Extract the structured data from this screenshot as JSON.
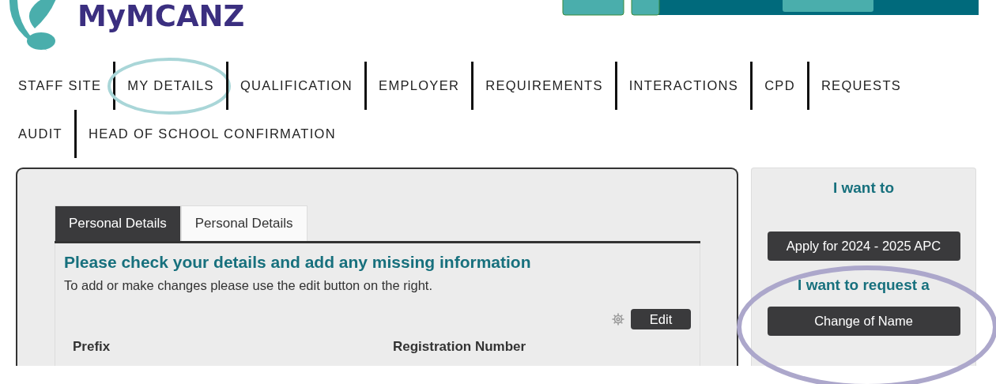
{
  "header": {
    "logo_text": "MyMCANZ"
  },
  "nav": {
    "rows": [
      [
        {
          "label": "STAFF SITE",
          "circled": false
        },
        {
          "label": "MY DETAILS",
          "circled": true
        },
        {
          "label": "QUALIFICATION",
          "circled": false
        },
        {
          "label": "EMPLOYER",
          "circled": false
        },
        {
          "label": "REQUIREMENTS",
          "circled": false
        },
        {
          "label": "INTERACTIONS",
          "circled": false
        },
        {
          "label": "CPD",
          "circled": false
        },
        {
          "label": "REQUESTS",
          "circled": false
        }
      ],
      [
        {
          "label": "AUDIT",
          "circled": false
        },
        {
          "label": "HEAD OF SCHOOL CONFIRMATION",
          "circled": false
        }
      ]
    ]
  },
  "main": {
    "tabs": [
      {
        "label": "Personal Details",
        "selected": true
      },
      {
        "label": "Personal Details",
        "selected": false
      }
    ],
    "heading": "Please check your details and add any missing information",
    "instructions": "To add or make changes please use the edit button on the right.",
    "edit_button": "Edit",
    "fields": [
      {
        "label": "Prefix"
      },
      {
        "label": "Registration Number"
      }
    ]
  },
  "sidebar": {
    "sections": [
      {
        "heading": "I want to",
        "button": "Apply for 2024 - 2025 APC"
      },
      {
        "heading": "I want to request a",
        "button": "Change of Name",
        "circled": true
      }
    ]
  }
}
